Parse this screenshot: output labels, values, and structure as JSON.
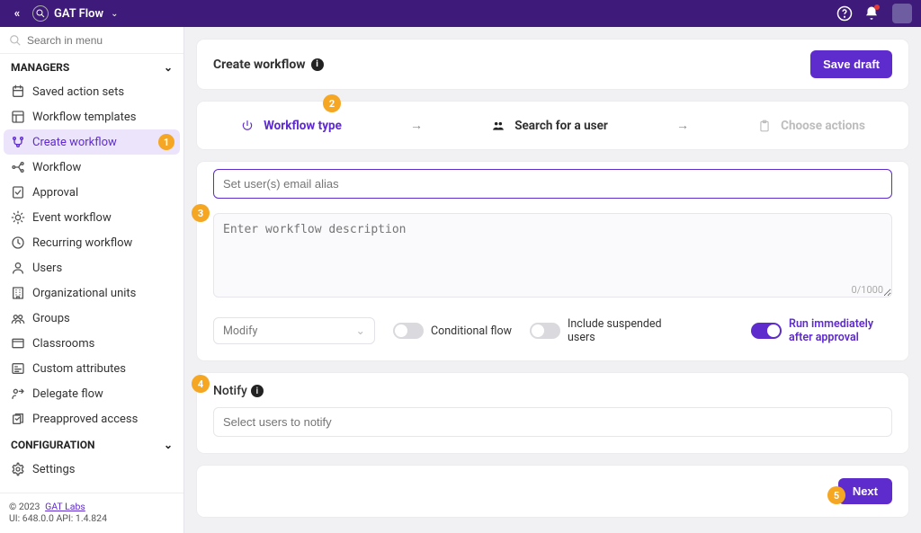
{
  "topbar": {
    "app_name": "GAT Flow"
  },
  "sidebar": {
    "search_placeholder": "Search in menu",
    "sections": {
      "managers": {
        "label": "MANAGERS",
        "items": [
          {
            "icon": "saved-sets",
            "label": "Saved action sets"
          },
          {
            "icon": "templates",
            "label": "Workflow templates"
          },
          {
            "icon": "create",
            "label": "Create workflow",
            "active": true,
            "badge": "1"
          },
          {
            "icon": "workflow",
            "label": "Workflow"
          },
          {
            "icon": "approval",
            "label": "Approval"
          },
          {
            "icon": "event",
            "label": "Event workflow"
          },
          {
            "icon": "recurring",
            "label": "Recurring workflow"
          },
          {
            "icon": "users",
            "label": "Users"
          },
          {
            "icon": "org",
            "label": "Organizational units"
          },
          {
            "icon": "groups",
            "label": "Groups"
          },
          {
            "icon": "classrooms",
            "label": "Classrooms"
          },
          {
            "icon": "custom",
            "label": "Custom attributes"
          },
          {
            "icon": "delegate",
            "label": "Delegate flow"
          },
          {
            "icon": "preapproved",
            "label": "Preapproved access"
          }
        ]
      },
      "configuration": {
        "label": "CONFIGURATION",
        "items": [
          {
            "icon": "settings",
            "label": "Settings"
          }
        ]
      }
    },
    "footer": {
      "copyright": "© 2023",
      "company": "GAT Labs",
      "version": "UI: 648.0.0 API: 1.4.824"
    }
  },
  "header": {
    "title": "Create workflow",
    "save_btn": "Save draft"
  },
  "steps": {
    "s1": "Workflow type",
    "s2": "Search for a user",
    "s3": "Choose actions",
    "badge2": "2"
  },
  "form": {
    "alias_placeholder": "Set user(s) email alias",
    "desc_placeholder": "Enter workflow description",
    "char_count": "0/1000",
    "select_value": "Modify",
    "opt_conditional": "Conditional flow",
    "opt_suspended": "Include suspended users",
    "opt_run": "Run immediately after approval",
    "badge3": "3",
    "badge4": "4"
  },
  "notify": {
    "title": "Notify",
    "placeholder": "Select users to notify"
  },
  "footer": {
    "next": "Next",
    "badge5": "5"
  }
}
